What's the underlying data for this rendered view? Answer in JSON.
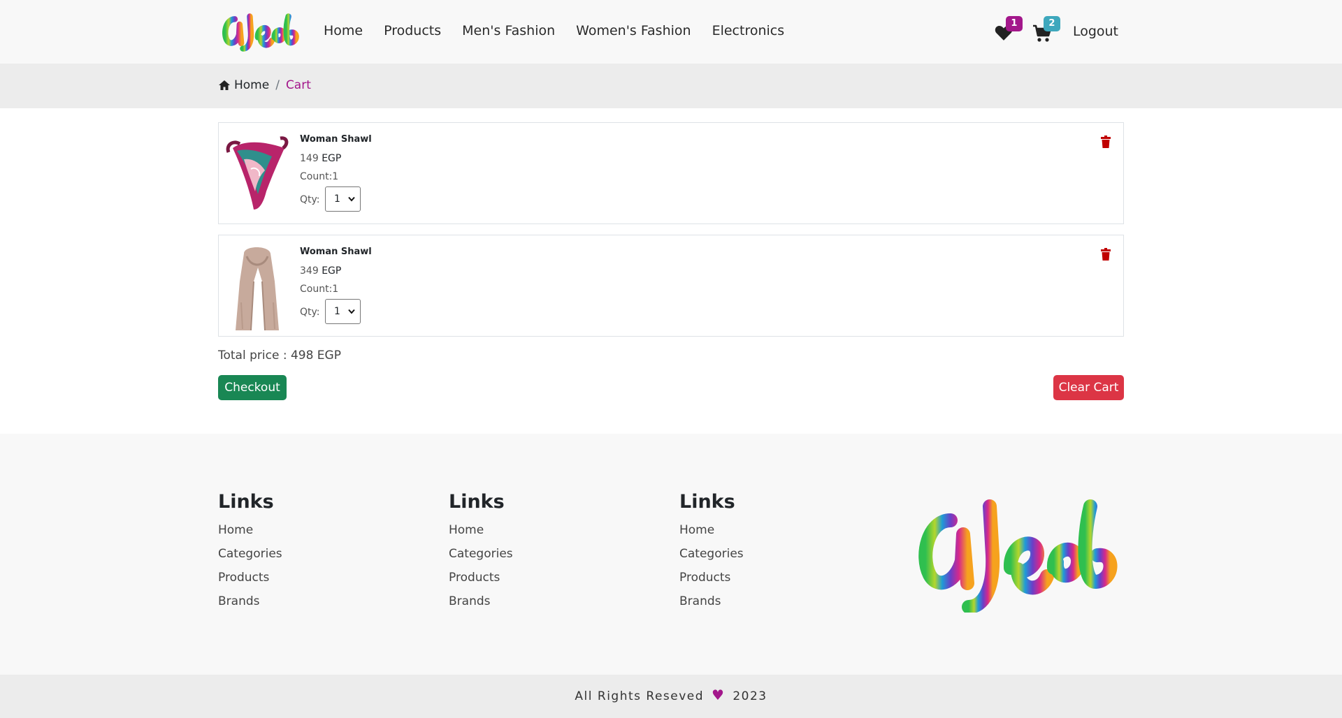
{
  "nav": {
    "brand": "ajeeb",
    "links": [
      "Home",
      "Products",
      "Men's Fashion",
      "Women's Fashion",
      "Electronics"
    ],
    "wishlist_count": "1",
    "cart_count": "2",
    "logout": "Logout",
    "wishlist_badge_color": "#a3178b",
    "cart_badge_color": "#3ea8bd"
  },
  "breadcrumb": {
    "home": "Home",
    "separator": "/",
    "current": "Cart"
  },
  "cart": {
    "items": [
      {
        "name": "Woman Shawl",
        "price": "149",
        "currency": "EGP",
        "count_label": "Count:",
        "count": "1",
        "qty_label": "Qty:",
        "qty": "1",
        "image": "patterned-silk-scarf"
      },
      {
        "name": "Woman Shawl",
        "price": "349",
        "currency": "EGP",
        "count_label": "Count:",
        "count": "1",
        "qty_label": "Qty:",
        "qty": "1",
        "image": "beige-knit-scarf"
      }
    ],
    "total": "Total price : 498 EGP",
    "checkout_label": "Checkout",
    "clear_label": "Clear Cart"
  },
  "footer": {
    "columns": [
      {
        "title": "Links",
        "links": [
          "Home",
          "Categories",
          "Products",
          "Brands"
        ]
      },
      {
        "title": "Links",
        "links": [
          "Home",
          "Categories",
          "Products",
          "Brands"
        ]
      },
      {
        "title": "Links",
        "links": [
          "Home",
          "Categories",
          "Products",
          "Brands"
        ]
      }
    ],
    "brand": "ajeeb"
  },
  "copyright": {
    "text_before": "All Rights Reseved",
    "heart": "♥",
    "year": "2023"
  },
  "colors": {
    "accent": "#a3178b",
    "checkout": "#198754",
    "clear": "#dc3545",
    "trash": "#c00000"
  }
}
